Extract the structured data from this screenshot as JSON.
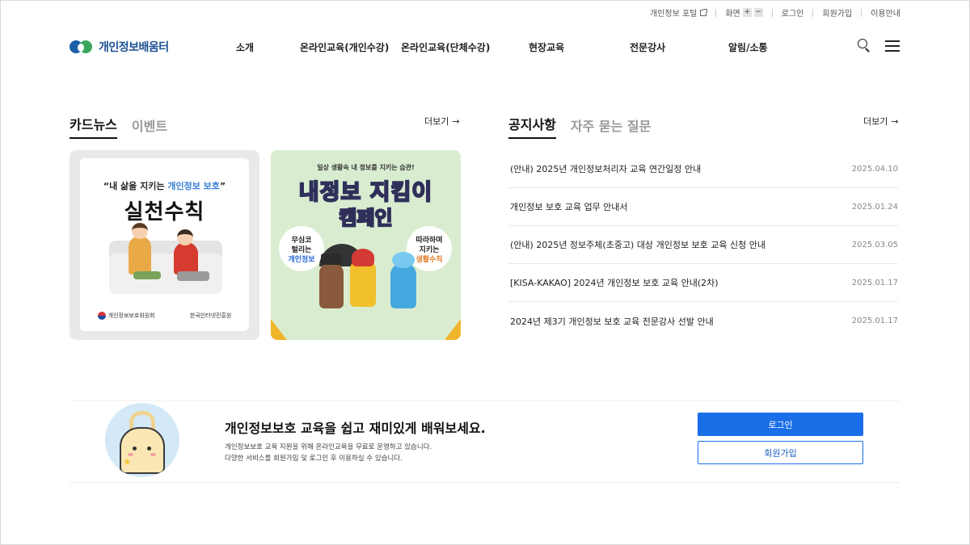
{
  "utility": {
    "portal": "개인정보 포털",
    "screen": "화면",
    "zoom_in": "+",
    "zoom_out": "−",
    "login": "로그인",
    "signup": "회원가입",
    "guide": "이용안내"
  },
  "header": {
    "logo_text": "개인정보배움터",
    "nav": [
      "소개",
      "온라인교육(개인수강)",
      "온라인교육(단체수강)",
      "현장교육",
      "전문강사",
      "알림/소통"
    ]
  },
  "left_section": {
    "tabs": [
      "카드뉴스",
      "이벤트"
    ],
    "active_tab": "카드뉴스",
    "more": "더보기",
    "cards": [
      {
        "quote_pre": "“내 삶을 지키는 ",
        "quote_em": "개인정보 보호",
        "quote_post": "”",
        "title": "실천수칙",
        "org1": "개인정보보호위원회",
        "org2": "한국인터넷진흥원"
      },
      {
        "subtitle": "일상 생활속 내 정보를 지키는 습관!",
        "title_line1": "내정보 지킴이",
        "title_line2": "캠페인",
        "bubble_left_1": "무심코",
        "bubble_left_2": "털리는",
        "bubble_left_3": "개인정보",
        "bubble_right_1": "따라하며",
        "bubble_right_2": "지키는",
        "bubble_right_3": "생활수칙"
      }
    ]
  },
  "right_section": {
    "tabs": [
      "공지사항",
      "자주 묻는 질문"
    ],
    "active_tab": "공지사항",
    "more": "더보기",
    "notices": [
      {
        "title": "(안내) 2025년 개인정보처리자 교육 연간일정 안내",
        "date": "2025.04.10"
      },
      {
        "title": "개인정보 보호 교육 업무 안내서",
        "date": "2025.01.24"
      },
      {
        "title": "(안내) 2025년 정보주체(초중고) 대상 개인정보 보호 교육 신청 안내",
        "date": "2025.03.05"
      },
      {
        "title": "[KISA-KAKAO] 2024년 개인정보 보호 교육 안내(2차)",
        "date": "2025.01.17"
      },
      {
        "title": "2024년 제3기 개인정보 보호 교육 전문강사 선발 안내",
        "date": "2025.01.17"
      }
    ]
  },
  "banner": {
    "title": "개인정보보호 교육을 쉽고 재미있게 배워보세요.",
    "desc_line1": "개인정보보호 교육 지원을 위해 온라인교육을 무료로 운영하고 있습니다.",
    "desc_line2": "다양한 서비스를 회원가입 및 로그인 후 이용하실 수 있습니다.",
    "login_button": "로그인",
    "signup_button": "회원가입"
  },
  "colors": {
    "primary": "#1a6ee8",
    "logo_blue": "#1b5fa8",
    "logo_green": "#3aa85c"
  }
}
